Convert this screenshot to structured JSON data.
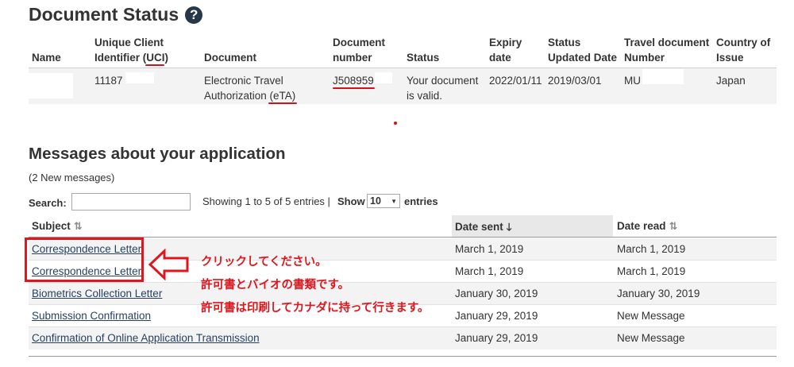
{
  "doc_status": {
    "title": "Document Status",
    "help_icon_glyph": "?",
    "columns": {
      "name": "Name",
      "uci_line1": "Unique Client",
      "uci_line2": "Identifier (UCI)",
      "document": "Document",
      "doc_number_line1": "Document",
      "doc_number_line2": "number",
      "status": "Status",
      "expiry_line1": "Expiry",
      "expiry_line2": "date",
      "updated_line1": "Status",
      "updated_line2": "Updated Date",
      "travel_line1": "Travel document",
      "travel_line2": "Number",
      "country_line1": "Country of",
      "country_line2": "Issue"
    },
    "row": {
      "uci": "11187",
      "document_line1": "Electronic Travel",
      "document_line2": "Authorization (eTA)",
      "doc_number": "J508959",
      "status_line1": "Your document",
      "status_line2": "is valid.",
      "expiry": "2022/01/11",
      "updated": "2019/03/01",
      "travel_doc": "MU",
      "country": "Japan"
    }
  },
  "messages": {
    "title": "Messages about your application",
    "new_count": "(2 New messages)",
    "search_label": "Search:",
    "search_value": "",
    "showing": "Showing 1 to 5 of 5 entries |",
    "show_label": "Show",
    "page_size": "10",
    "entries_label": "entries",
    "columns": {
      "subject": "Subject",
      "date_sent": "Date sent",
      "date_read": "Date read"
    },
    "rows": [
      {
        "subject": "Correspondence Letter",
        "date_sent": "March 1, 2019",
        "date_read": "March 1, 2019"
      },
      {
        "subject": "Correspondence Letter",
        "date_sent": "March 1, 2019",
        "date_read": "March 1, 2019"
      },
      {
        "subject": "Biometrics Collection Letter",
        "date_sent": "January 30, 2019",
        "date_read": "January 30, 2019"
      },
      {
        "subject": "Submission Confirmation",
        "date_sent": "January 29, 2019",
        "date_read": "New Message"
      },
      {
        "subject": "Confirmation of Online Application Transmission",
        "date_sent": "January 29, 2019",
        "date_read": "New Message"
      }
    ]
  },
  "annotations": {
    "line1": "クリックしてください。",
    "line2": "許可書とバイオの書類です。",
    "line3": "許可書は印刷してカナダに持って行きます。"
  },
  "colors": {
    "heading": "#333333",
    "link": "#284162",
    "annotation_red": "#e0161e",
    "help_icon_bg": "#26374a"
  }
}
